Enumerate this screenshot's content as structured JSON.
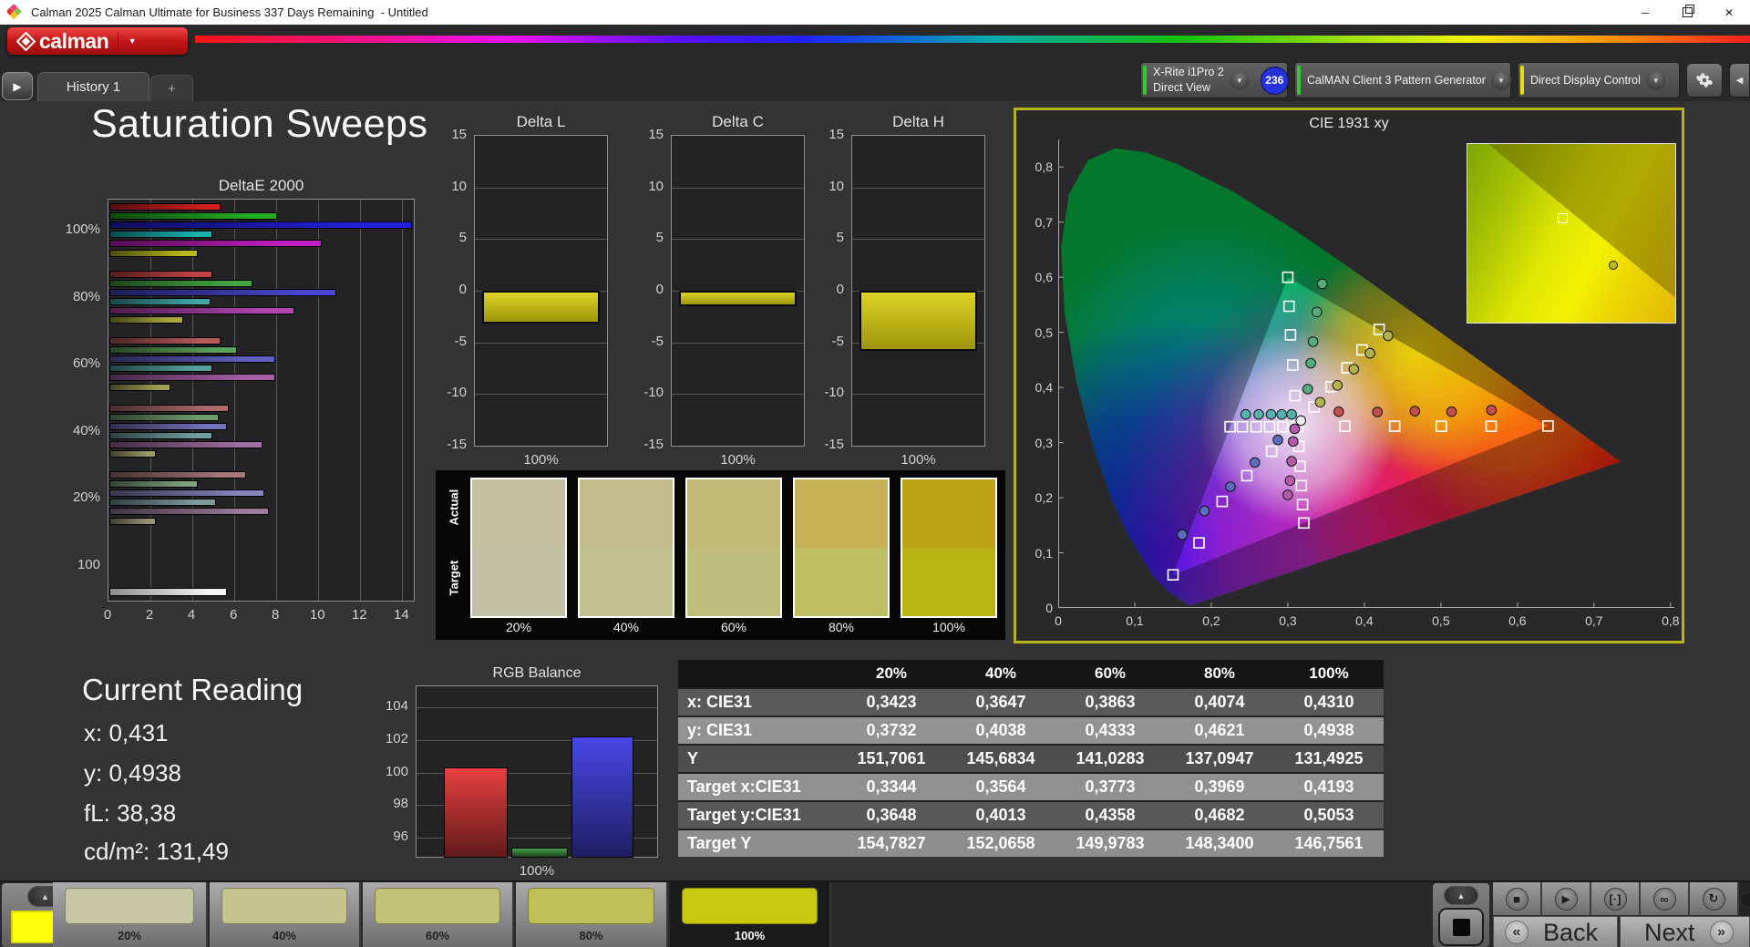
{
  "window": {
    "title": "Calman 2025 Calman Ultimate for Business 337 Days Remaining  - Untitled"
  },
  "icons": {
    "dropdown_caret": "▼",
    "collapse_left": "◀",
    "tab_scroll": "▶",
    "up_arrow": "▲",
    "minimize": "─",
    "close": "✕"
  },
  "logo": {
    "text": "calman"
  },
  "tab_bar": {
    "history_tab": "History 1",
    "add_tab": "+"
  },
  "device_bar": {
    "meter": {
      "line1": "X-Rite i1Pro 2",
      "line2": "Direct View",
      "badge": "236",
      "accent": "#2ecc2e"
    },
    "pattern_source": {
      "label": "CalMAN Client 3 Pattern Generator",
      "accent": "#2ecc2e"
    },
    "display_control": {
      "label": "Direct Display Control",
      "accent": "#e8d81c"
    }
  },
  "page": {
    "title": "Saturation Sweeps"
  },
  "current_reading": {
    "title": "Current Reading",
    "lines": [
      "x: 0,431",
      "y: 0,4938",
      "fL: 38,38",
      "cd/m²: 131,49"
    ]
  },
  "pattern_bar": {
    "current_color": "#ffff0a",
    "selected_index": 4,
    "levels": [
      {
        "label": "20%",
        "color": "#c7c7a6"
      },
      {
        "label": "40%",
        "color": "#c5c48f"
      },
      {
        "label": "60%",
        "color": "#c2c277"
      },
      {
        "label": "80%",
        "color": "#bfbf58"
      },
      {
        "label": "100%",
        "color": "#c8c80e"
      }
    ]
  },
  "transport": {
    "buttons": [
      {
        "name": "stop",
        "glyph": "■"
      },
      {
        "name": "play",
        "glyph": "▶"
      },
      {
        "name": "single-measure",
        "glyph": "[·]"
      },
      {
        "name": "continuous",
        "glyph": "∞"
      },
      {
        "name": "refresh",
        "glyph": "↻"
      }
    ],
    "back_label": "Back",
    "next_label": "Next",
    "back_icon": "«",
    "next_icon": "»"
  },
  "chart_data": [
    {
      "id": "deltae_2000",
      "type": "bar",
      "orientation": "horizontal",
      "title": "DeltaE 2000",
      "xlim": [
        0,
        14.55
      ],
      "xticks": [
        "0",
        "2",
        "4",
        "6",
        "8",
        "10",
        "12",
        "14"
      ],
      "group_labels": [
        "100%",
        "80%",
        "60%",
        "40%",
        "20%",
        "100"
      ],
      "series_order": [
        "red",
        "green",
        "blue",
        "cyan",
        "magenta",
        "yellow"
      ],
      "groups": [
        {
          "label": "100%",
          "values": [
            5.3,
            8.0,
            14.4,
            4.9,
            10.1,
            4.2
          ],
          "colors": [
            "#cf1f1f",
            "#22b022",
            "#2222dd",
            "#18b2b2",
            "#c41fc4",
            "#b9b91e"
          ]
        },
        {
          "label": "80%",
          "values": [
            4.9,
            6.8,
            10.8,
            4.8,
            8.8,
            3.5
          ],
          "colors": [
            "#c24444",
            "#43a843",
            "#4747cf",
            "#3fa5a5",
            "#b545b5",
            "#aaa93c"
          ]
        },
        {
          "label": "60%",
          "values": [
            5.3,
            6.1,
            7.9,
            4.9,
            7.9,
            2.9
          ],
          "colors": [
            "#b85c5c",
            "#5ca25c",
            "#6161c4",
            "#58a0a0",
            "#a85ea8",
            "#a3a156"
          ]
        },
        {
          "label": "40%",
          "values": [
            5.7,
            5.2,
            5.6,
            4.9,
            7.3,
            2.2
          ],
          "colors": [
            "#b06c6c",
            "#6f9f6f",
            "#7474bd",
            "#6d9f9f",
            "#a06da0",
            "#9c9a68"
          ]
        },
        {
          "label": "20%",
          "values": [
            6.5,
            4.2,
            7.4,
            5.1,
            7.6,
            2.2
          ],
          "colors": [
            "#a87878",
            "#7f9f7f",
            "#8484bb",
            "#7d9d9d",
            "#9c7b9c",
            "#959372"
          ]
        }
      ],
      "white_bar": {
        "label": "100",
        "value": 5.6,
        "color": "#ececec"
      }
    },
    {
      "id": "delta_lch",
      "type": "bar",
      "ylim": [
        -15,
        15
      ],
      "yticks": [
        15,
        10,
        5,
        0,
        -5,
        -10,
        -15
      ],
      "xlabel": "100%",
      "bar_color": "#c8c214",
      "charts": [
        {
          "title": "Delta L",
          "value": -3.2
        },
        {
          "title": "Delta C",
          "value": -1.5
        },
        {
          "title": "Delta H",
          "value": -5.8
        }
      ]
    },
    {
      "id": "saturation_swatches",
      "type": "table",
      "row_labels": [
        "Actual",
        "Target"
      ],
      "levels": [
        "20%",
        "40%",
        "60%",
        "80%",
        "100%"
      ],
      "actual_colors": [
        "#c3bf9f",
        "#c3bb89",
        "#c4b878",
        "#c7b258",
        "#bba216"
      ],
      "target_colors": [
        "#c1c2a5",
        "#c1c090",
        "#bfbe7c",
        "#bfbe61",
        "#b8b513"
      ]
    },
    {
      "id": "cie_1931_xy",
      "type": "scatter",
      "title": "CIE 1931 xy",
      "xlim": [
        0,
        0.8
      ],
      "ylim": [
        0,
        0.8
      ],
      "xtick_labels": [
        "0",
        "0,1",
        "0,2",
        "0,3",
        "0,4",
        "0,5",
        "0,6",
        "0,7",
        "0,8"
      ],
      "ytick_labels": [
        "0",
        "0,1",
        "0,2",
        "0,3",
        "0,4",
        "0,5",
        "0,6",
        "0,7",
        "0,8"
      ],
      "gamut_triangle": [
        [
          0.64,
          0.33
        ],
        [
          0.3,
          0.6
        ],
        [
          0.15,
          0.06
        ]
      ],
      "series": [
        {
          "name": "red",
          "color": "#c05050",
          "targets": [
            [
              0.3744,
              0.3295
            ],
            [
              0.4397,
              0.3297
            ],
            [
              0.5005,
              0.3296
            ],
            [
              0.5657,
              0.3295
            ],
            [
              0.64,
              0.33
            ]
          ],
          "measured": [
            [
              0.3665,
              0.356
            ],
            [
              0.417,
              0.3555
            ],
            [
              0.466,
              0.357
            ],
            [
              0.514,
              0.356
            ],
            [
              0.566,
              0.359
            ]
          ]
        },
        {
          "name": "green",
          "color": "#53ae7c",
          "targets": [
            [
              0.3095,
              0.3852
            ],
            [
              0.3064,
              0.4407
            ],
            [
              0.3036,
              0.4954
            ],
            [
              0.3015,
              0.5474
            ],
            [
              0.3,
              0.6
            ]
          ],
          "measured": [
            [
              0.326,
              0.397
            ],
            [
              0.33,
              0.444
            ],
            [
              0.333,
              0.483
            ],
            [
              0.338,
              0.537
            ],
            [
              0.345,
              0.588
            ]
          ]
        },
        {
          "name": "blue",
          "color": "#5c6cc0",
          "targets": [
            [
              0.2788,
              0.2843
            ],
            [
              0.2465,
              0.2399
            ],
            [
              0.2142,
              0.1933
            ],
            [
              0.184,
              0.118
            ],
            [
              0.15,
              0.06
            ]
          ],
          "measured": [
            [
              0.287,
              0.305
            ],
            [
              0.257,
              0.264
            ],
            [
              0.225,
              0.22
            ],
            [
              0.191,
              0.176
            ],
            [
              0.162,
              0.133
            ]
          ]
        },
        {
          "name": "cyan",
          "color": "#57b0b0",
          "targets": [
            [
              0.2937,
              0.3288
            ],
            [
              0.2761,
              0.3288
            ],
            [
              0.2585,
              0.3288
            ],
            [
              0.2405,
              0.3288
            ],
            [
              0.2246,
              0.3288
            ]
          ],
          "measured": [
            [
              0.305,
              0.351
            ],
            [
              0.292,
              0.351
            ],
            [
              0.278,
              0.351
            ],
            [
              0.262,
              0.351
            ],
            [
              0.245,
              0.351
            ]
          ]
        },
        {
          "name": "magenta",
          "color": "#b35ba8",
          "targets": [
            [
              0.3144,
              0.2931
            ],
            [
              0.3161,
              0.2572
            ],
            [
              0.3177,
              0.2219
            ],
            [
              0.3193,
              0.1874
            ],
            [
              0.3209,
              0.1542
            ]
          ],
          "measured": [
            [
              0.309,
              0.325
            ],
            [
              0.307,
              0.302
            ],
            [
              0.305,
              0.266
            ],
            [
              0.303,
              0.231
            ],
            [
              0.3,
              0.205
            ]
          ]
        },
        {
          "name": "yellow",
          "color": "#b2b34e",
          "targets": [
            [
              0.3344,
              0.3648
            ],
            [
              0.3564,
              0.4013
            ],
            [
              0.3773,
              0.4358
            ],
            [
              0.3969,
              0.4682
            ],
            [
              0.4193,
              0.5053
            ]
          ],
          "measured": [
            [
              0.3423,
              0.3732
            ],
            [
              0.3647,
              0.4038
            ],
            [
              0.3863,
              0.4333
            ],
            [
              0.4074,
              0.4621
            ],
            [
              0.431,
              0.4938
            ]
          ]
        },
        {
          "name": "white",
          "color": "#f0f0f0",
          "targets": [
            [
              0.3127,
              0.329
            ]
          ],
          "measured": [
            [
              0.317,
              0.34
            ]
          ]
        }
      ],
      "inset": {
        "square": [
          0.46,
          0.42
        ],
        "circle": [
          0.7,
          0.68
        ]
      }
    },
    {
      "id": "rgb_balance",
      "type": "bar",
      "title": "RGB Balance",
      "categories": [
        "Red",
        "Green",
        "Blue"
      ],
      "values": [
        100.3,
        95.4,
        102.2
      ],
      "colors": [
        "#e84040",
        "#44a04c",
        "#4848e8"
      ],
      "ylim": [
        94.7,
        105.3
      ],
      "yticks": [
        104,
        102,
        100,
        98,
        96
      ],
      "xlabel": "100%"
    },
    {
      "id": "results_table",
      "type": "table",
      "columns": [
        "",
        "20%",
        "40%",
        "60%",
        "80%",
        "100%"
      ],
      "rows": [
        {
          "label": "x: CIE31",
          "values": [
            "0,3423",
            "0,3647",
            "0,3863",
            "0,4074",
            "0,4310"
          ]
        },
        {
          "label": "y: CIE31",
          "values": [
            "0,3732",
            "0,4038",
            "0,4333",
            "0,4621",
            "0,4938"
          ]
        },
        {
          "label": "Y",
          "values": [
            "151,7061",
            "145,6834",
            "141,0283",
            "137,0947",
            "131,4925"
          ]
        },
        {
          "label": "Target x:CIE31",
          "values": [
            "0,3344",
            "0,3564",
            "0,3773",
            "0,3969",
            "0,4193"
          ]
        },
        {
          "label": "Target y:CIE31",
          "values": [
            "0,3648",
            "0,4013",
            "0,4358",
            "0,4682",
            "0,5053"
          ]
        },
        {
          "label": "Target Y",
          "values": [
            "154,7827",
            "152,0658",
            "149,9783",
            "148,3400",
            "146,7561"
          ]
        }
      ]
    }
  ]
}
